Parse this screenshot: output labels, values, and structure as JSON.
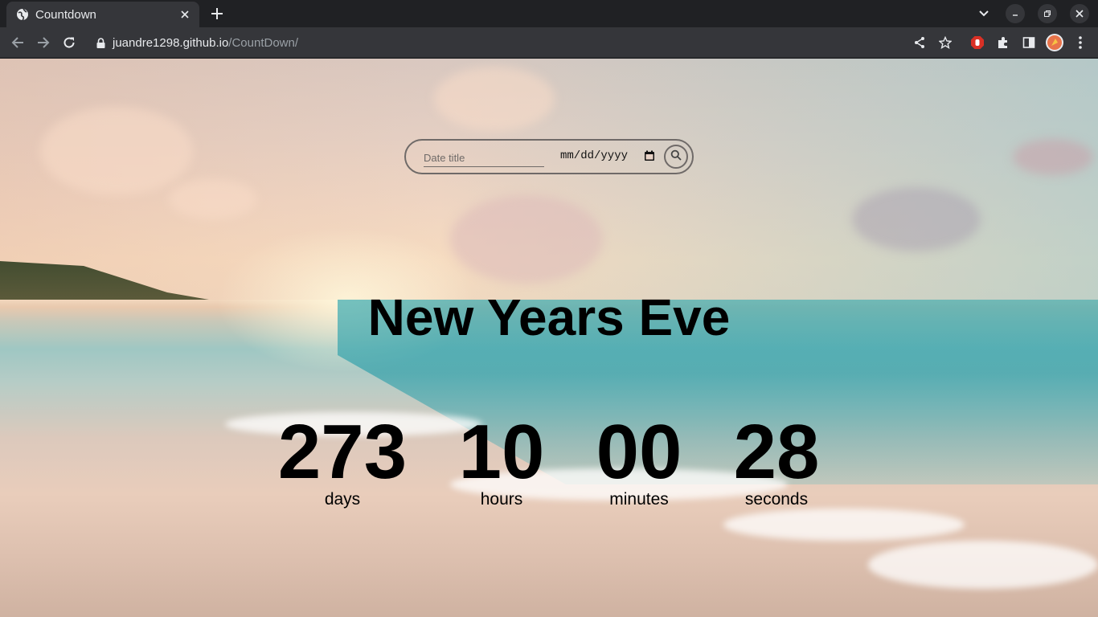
{
  "browser": {
    "tab_title": "Countdown",
    "url_host": "juandre1298.github.io",
    "url_path": "/CountDown/"
  },
  "search": {
    "title_placeholder": "Date title",
    "date_placeholder": "mm/dd/yyyy"
  },
  "event": {
    "title": "New Years Eve"
  },
  "countdown": [
    {
      "value": "273",
      "label": "days"
    },
    {
      "value": "10",
      "label": "hours"
    },
    {
      "value": "00",
      "label": "minutes"
    },
    {
      "value": "28",
      "label": "seconds"
    }
  ],
  "icons": {
    "favicon": "globe-icon",
    "profile": "avatar-icon"
  },
  "colors": {
    "chrome_bg": "#202124",
    "toolbar_bg": "#35363a",
    "text": "#000000",
    "search_border": "#6f6a68"
  }
}
